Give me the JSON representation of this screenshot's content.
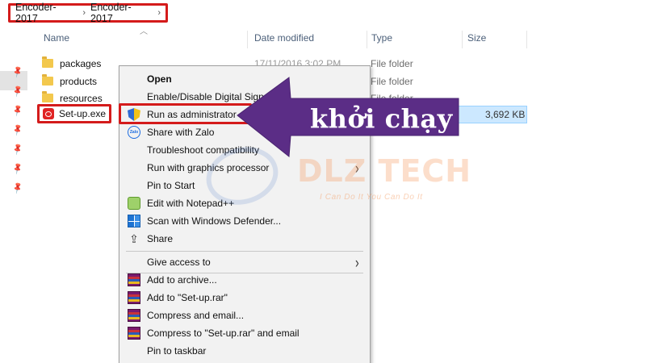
{
  "breadcrumb": [
    "Encoder-2017",
    "Encoder-2017"
  ],
  "columns": {
    "name": "Name",
    "date_modified": "Date modified",
    "type": "Type",
    "size": "Size"
  },
  "files": [
    {
      "name": "packages",
      "date": "17/11/2016 3:02 PM",
      "type": "File folder",
      "size": ""
    },
    {
      "name": "products",
      "date": "",
      "type": "File folder",
      "size": ""
    },
    {
      "name": "resources",
      "date": "",
      "type": "File folder",
      "size": ""
    },
    {
      "name": "Set-up.exe",
      "date": "",
      "type": "",
      "size": "3,692 KB"
    }
  ],
  "context_menu": {
    "items": [
      {
        "label": "Open",
        "bold": true
      },
      {
        "label": "Enable/Disable Digital Sign"
      },
      {
        "label": "Run as administrator",
        "icon": "shield-icon"
      },
      {
        "label": "Share with Zalo",
        "icon": "zalo-icon",
        "icon_text": "Zalo"
      },
      {
        "label": "Troubleshoot compatibility"
      },
      {
        "label": "Run with graphics processor",
        "submenu": true
      },
      {
        "label": "Pin to Start"
      },
      {
        "label": "Edit with Notepad++",
        "icon": "notepad-plus-plus-icon"
      },
      {
        "label": "Scan with Windows Defender...",
        "icon": "windows-defender-icon"
      },
      {
        "label": "Share",
        "icon": "share-icon"
      },
      {
        "label": "Give access to",
        "submenu": true
      },
      {
        "label": "Add to archive...",
        "icon": "winrar-icon"
      },
      {
        "label": "Add to \"Set-up.rar\"",
        "icon": "winrar-icon"
      },
      {
        "label": "Compress and email...",
        "icon": "winrar-icon"
      },
      {
        "label": "Compress to \"Set-up.rar\" and email",
        "icon": "winrar-icon"
      },
      {
        "label": "Pin to taskbar"
      }
    ]
  },
  "annotation": {
    "text": "khởi chạy",
    "arrow_color": "#5b2d86"
  },
  "watermark": {
    "brand": "DLZ TECH",
    "slogan": "I Can Do It You Can Do It"
  },
  "colors": {
    "highlight_box": "#d41b1b",
    "selection": "#cce8ff",
    "menu_bg": "#f2f2f2"
  }
}
